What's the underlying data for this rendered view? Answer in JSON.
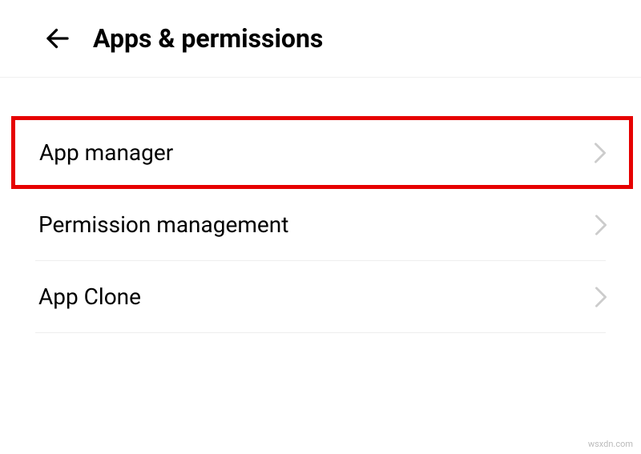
{
  "header": {
    "title": "Apps & permissions"
  },
  "items": [
    {
      "label": "App manager"
    },
    {
      "label": "Permission management"
    },
    {
      "label": "App Clone"
    }
  ],
  "watermark": "wsxdn.com"
}
